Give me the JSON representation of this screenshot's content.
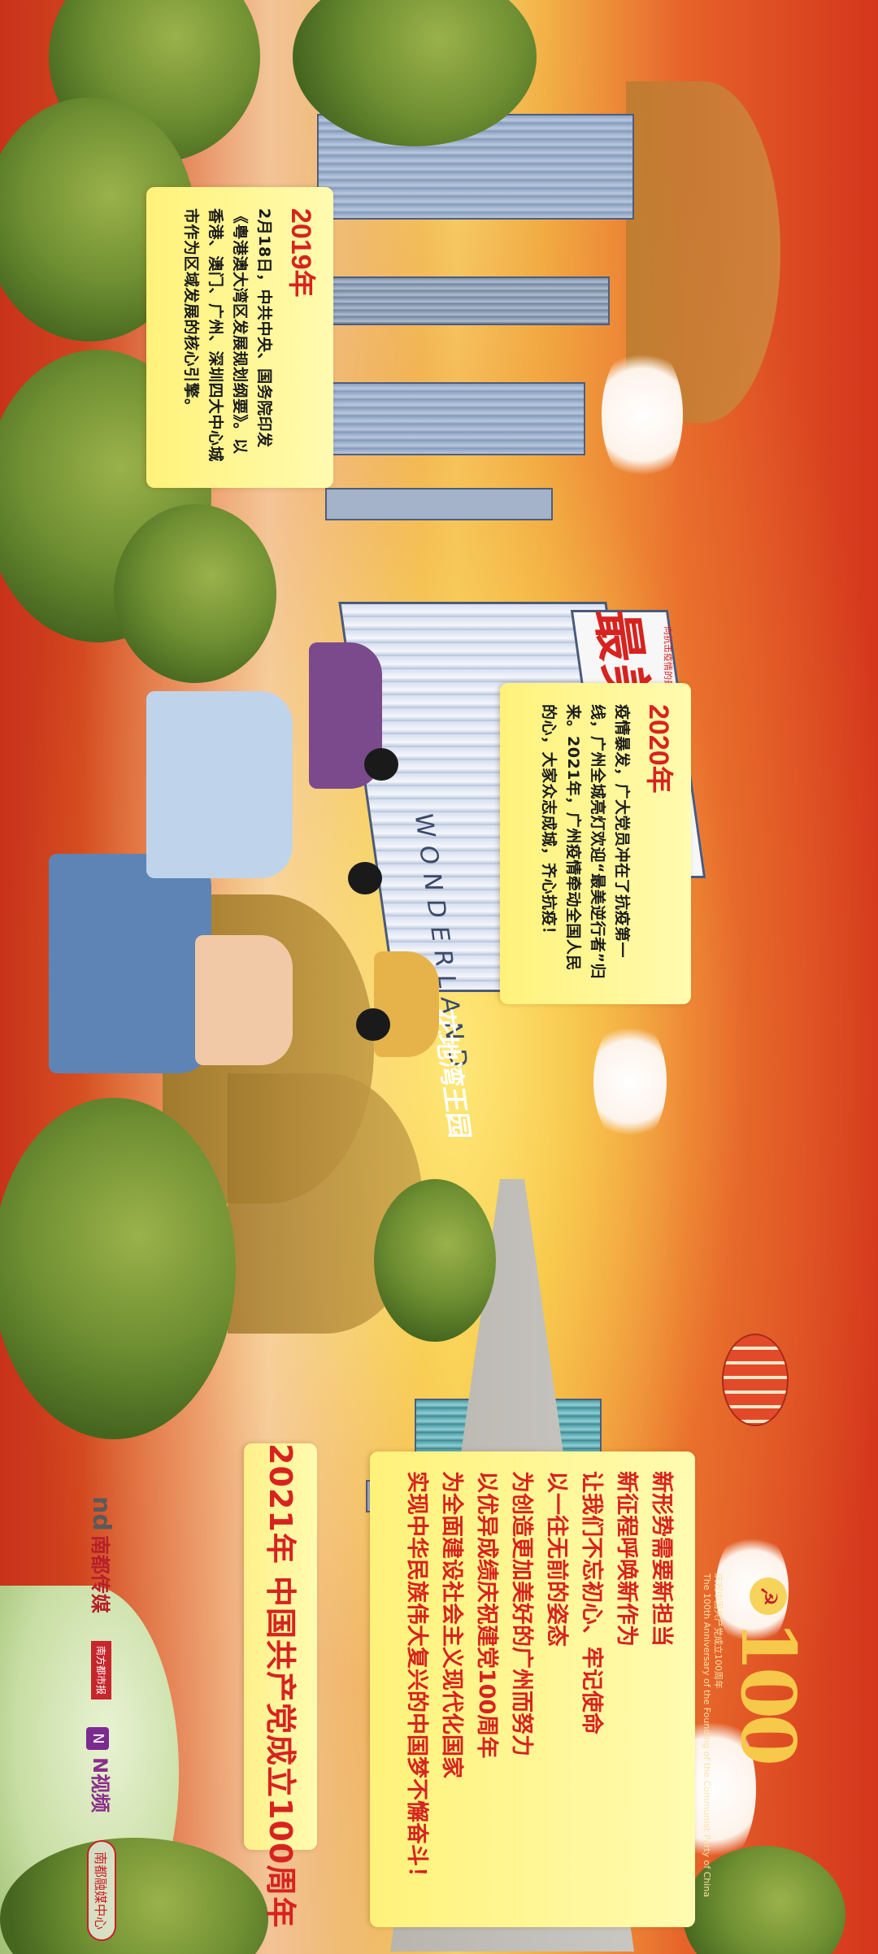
{
  "panel_2019": {
    "year": "2019年",
    "text": "2月18日，中共中央、国务院印发《粤港澳大湾区发展规划纲要》。以香港、澳门、广州、深圳四大中心城市作为区域发展的核心引擎。"
  },
  "panel_2020": {
    "year": "2020年",
    "text": "疫情暴发，广大党员冲在了抗疫第一线，广州全城亮灯欢迎“最美逆行者”归来。2021年，广州疫情牵动全国人民的心，大家众志成城，齐心抗疫！"
  },
  "panel_2021": {
    "title": "2021年 中国共产党成立100周年",
    "motto": [
      "新形势需要新担当",
      "新征程呼唤新作为",
      "让我们不忘初心、牢记使命",
      "以一往无前的姿态",
      "为创造更加美好的广州而努力",
      "以优异成绩庆祝建党100周年",
      "为全面建设社会主义现代化国家",
      "实现中华民族伟大复兴的中国梦不懈奋斗！"
    ]
  },
  "sign": {
    "slogan": "最美逆行者",
    "subtitle": "向抗击疫情的最美逆行者致敬",
    "wonder": "WONDERLAND",
    "park": "花地湾王园"
  },
  "logo": {
    "number": "100",
    "caption_cn": "庆祝中国共产党成立100周年",
    "caption_en": "The 100th Anniversary of the Founding of the Communist Party of China"
  },
  "brands": {
    "nd_mark": "nd",
    "nd_name": "南都传媒",
    "nd_tag": "南方都市报",
    "n_mark": "N",
    "n_name": "N视频",
    "center": "南都融媒中心"
  },
  "colors": {
    "accent_red": "#d7231f",
    "panel_yellow": "#fff27a",
    "sky_orange": "#e6622a"
  }
}
